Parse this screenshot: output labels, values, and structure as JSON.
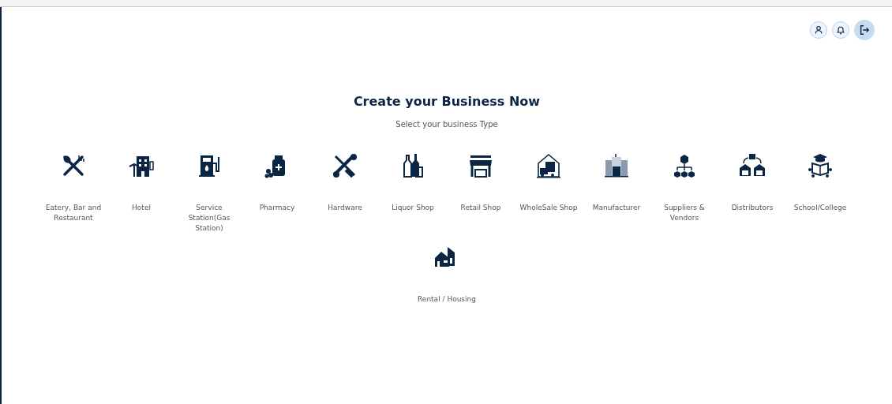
{
  "heading": {
    "title": "Create your Business Now",
    "subtitle": "Select your business Type"
  },
  "business_types": [
    {
      "label": "Eatery, Bar and Restaurant",
      "kind": "eatery"
    },
    {
      "label": "Hotel",
      "kind": "hotel"
    },
    {
      "label": "Service Station(Gas Station)",
      "kind": "gas"
    },
    {
      "label": "Pharmacy",
      "kind": "pharmacy"
    },
    {
      "label": "Hardware",
      "kind": "hardware"
    },
    {
      "label": "Liquor Shop",
      "kind": "liquor"
    },
    {
      "label": "Retail Shop",
      "kind": "retail"
    },
    {
      "label": "WholeSale Shop",
      "kind": "wholesale"
    },
    {
      "label": "Manufacturer",
      "kind": "manufacturer"
    },
    {
      "label": "Suppliers & Vendors",
      "kind": "suppliers"
    },
    {
      "label": "Distributors",
      "kind": "distributors"
    },
    {
      "label": "School/College",
      "kind": "school"
    },
    {
      "label": "Rental / Housing",
      "kind": "rental"
    }
  ]
}
